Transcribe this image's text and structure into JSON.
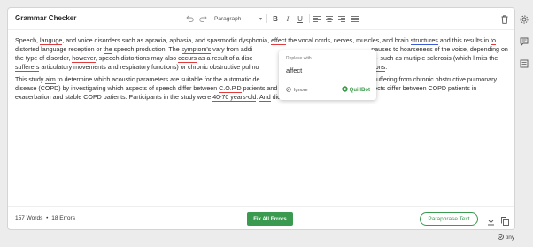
{
  "header": {
    "title": "Grammar Checker",
    "paragraph_select": "Paragraph"
  },
  "content": {
    "p1": [
      {
        "t": "Speech, "
      },
      {
        "t": "languge",
        "e": "red"
      },
      {
        "t": ", and voice disorders such as apraxia, aphasia, and spasmodic dysphonia, "
      },
      {
        "t": "effect",
        "e": "red"
      },
      {
        "t": " the vocal cords, nerves, muscles, and brain "
      },
      {
        "t": "structures",
        "e": "blue"
      },
      {
        "t": " and this results in "
      },
      {
        "t": "to",
        "e": "red"
      },
      {
        "t": " distorted language reception or "
      },
      {
        "t": "the",
        "e": "red"
      },
      {
        "t": " speech production. The "
      },
      {
        "t": "symptom's",
        "e": "red"
      },
      {
        "t": " vary from addi"
      },
      {
        "t": "                                                                    "
      },
      {
        "t": "pauses to hoarseness of the voice, depending on the type of disorder, "
      },
      {
        "t": "however",
        "e": "red"
      },
      {
        "t": ", speech distortions may also "
      },
      {
        "t": "occurs",
        "e": "red"
      },
      {
        "t": " as a result of a dise"
      },
      {
        "t": "                                                                  "
      },
      {
        "t": "ch",
        "e": "red"
      },
      {
        "t": " - such as multiple sclerosis (which limits the "
      },
      {
        "t": "sufferers",
        "e": "red"
      },
      {
        "t": " articulatory movements and respiratory functions) or chronic obstructive pulmo"
      },
      {
        "t": "                                        "
      },
      {
        "t": "respiratory "
      },
      {
        "t": "functions",
        "e": "red"
      },
      {
        "t": "."
      }
    ],
    "p2": [
      {
        "t": "This study "
      },
      {
        "t": "aim",
        "e": "red"
      },
      {
        "t": " to determine which acoustic parameters are suitable for the automatic de"
      },
      {
        "t": "                                                             "
      },
      {
        "t": "nt",
        "e": "red"
      },
      {
        "t": " suffering from chronic obstructive pulmonary disease (COPD) by investigating which aspects of speech differ between "
      },
      {
        "t": "C.O.P.D",
        "e": "red"
      },
      {
        "t": " patients and "
      },
      {
        "t": "a",
        "e": "red"
      },
      {
        "t": " healthy speakers and which aspects differ between COPD patients in exacerbation and stable COPD patients. Participants in the study were "
      },
      {
        "t": "40-70 years-old",
        "e": "red"
      },
      {
        "t": ". "
      },
      {
        "t": "And",
        "e": "red"
      },
      {
        "t": " did not smoke."
      }
    ]
  },
  "popup": {
    "heading": "Replace with",
    "suggestion": "affect",
    "ignore": "Ignore",
    "brand": "QuillBot"
  },
  "footer": {
    "words": "157 Words",
    "separator": "•",
    "errors": "18 Errors",
    "fix_all": "Fix All Errors",
    "paraphrase": "Paraphrase Text"
  },
  "brand_mark": "tiny",
  "colors": {
    "accent": "#3a9a50",
    "error_underline": "#e23b3b",
    "suggestion_underline": "#3c5bd6"
  },
  "icons": [
    "undo-icon",
    "redo-icon",
    "bold-icon",
    "italic-icon",
    "underline-icon",
    "align-left-icon",
    "align-center-icon",
    "align-right-icon",
    "align-justify-icon",
    "trash-icon",
    "download-icon",
    "copy-icon",
    "ignore-icon",
    "quillbot-logo-icon",
    "settings-icon",
    "comment-icon",
    "list-icon",
    "tiny-logo-icon"
  ]
}
